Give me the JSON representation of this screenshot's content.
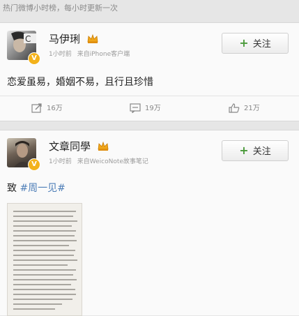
{
  "header": {
    "note": "热门微博小时榜，每小时更新一次"
  },
  "posts": [
    {
      "author": "马伊琍",
      "time": "1小时前",
      "source": "来自iPhone客户端",
      "follow_label": "关注",
      "text": "恋爱虽易，婚姻不易，且行且珍惜",
      "reposts": "16万",
      "comments": "19万",
      "likes": "21万"
    },
    {
      "author": "文章同學",
      "time": "1小时前",
      "source": "来自WeicoNote故事笔记",
      "follow_label": "关注",
      "text_prefix": "致",
      "topic": "#周一见#"
    }
  ],
  "colors": {
    "topic": "#4f7fb8",
    "plus": "#4a9a3a",
    "badge": "#f3b21b"
  },
  "icons": [
    "crown-icon",
    "verified-icon",
    "repost-icon",
    "comment-icon",
    "like-icon",
    "plus-icon"
  ]
}
